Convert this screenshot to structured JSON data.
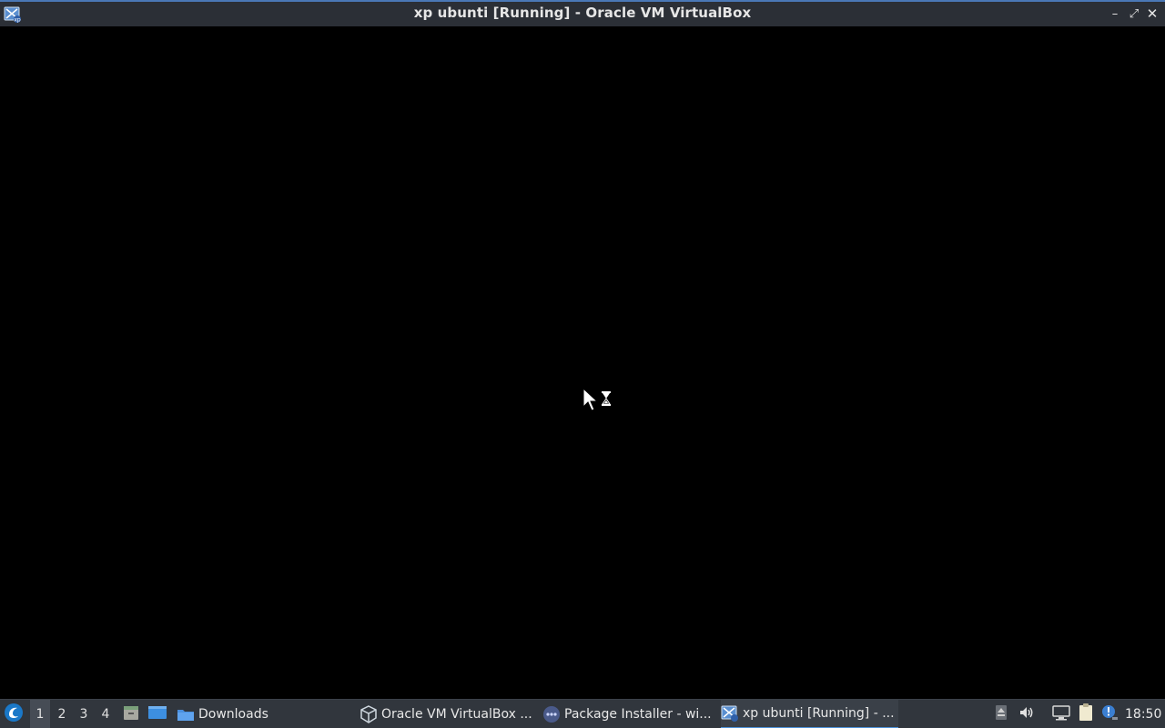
{
  "window": {
    "title": "xp ubunti [Running] - Oracle VM VirtualBox",
    "app_icon": "virtualbox-vm-icon",
    "controls": {
      "minimize": "–",
      "maximize": "⤢",
      "close": "✕"
    }
  },
  "vm_screen": {
    "cursor": "busy-pointer-icon"
  },
  "taskbar": {
    "start_icon": "lxqt-start-icon",
    "workspaces": [
      "1",
      "2",
      "3",
      "4"
    ],
    "active_workspace": "1",
    "quick_launch": [
      {
        "name": "file-manager-launcher",
        "icon": "folder-drawer-icon"
      },
      {
        "name": "show-desktop",
        "icon": "desktop-icon"
      }
    ],
    "tasks": [
      {
        "label": "Downloads",
        "icon": "folder-icon",
        "active": false
      },
      {
        "label": "Oracle VM VirtualBox ...",
        "icon": "virtualbox-icon",
        "active": false
      },
      {
        "label": "Package Installer - wi...",
        "icon": "package-installer-icon",
        "active": false
      },
      {
        "label": "xp ubunti [Running] - ...",
        "icon": "virtualbox-vm-icon",
        "active": true
      }
    ],
    "tray": {
      "icons": [
        "eject-icon",
        "volume-icon",
        "network-icon",
        "clipboard-icon",
        "notification-icon"
      ],
      "clock": "18:50"
    }
  },
  "colors": {
    "titlebar_bg": "#2b2f36",
    "taskbar_bg": "#31363d",
    "accent": "#4a90d9",
    "screen_bg": "#000000"
  }
}
